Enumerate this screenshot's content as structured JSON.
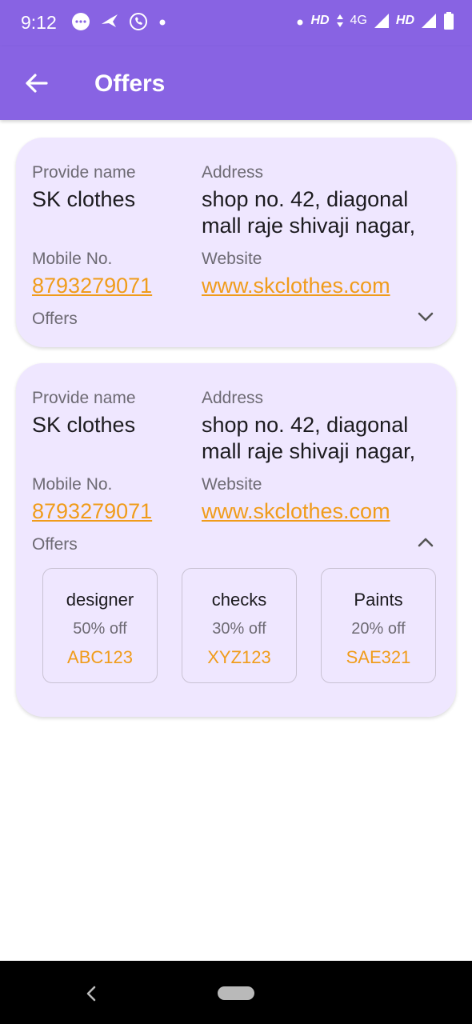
{
  "status_bar": {
    "time": "9:12",
    "left_icons": [
      "messenger-icon",
      "notification-icon",
      "call-icon",
      "dot-icon"
    ],
    "right_text": [
      "HD",
      "4G",
      "HD"
    ],
    "right_icons": [
      "dot-icon",
      "data-arrows-icon",
      "signal-icon",
      "signal-icon",
      "battery-icon"
    ]
  },
  "app_bar": {
    "title": "Offers",
    "back_icon": "arrow-left-icon"
  },
  "cards": [
    {
      "provider_label": "Provide name",
      "provider_value": "SK clothes",
      "address_label": "Address",
      "address_line1": "shop no. 42, diagonal",
      "address_line2": "mall raje shivaji nagar,",
      "mobile_label": "Mobile No.",
      "mobile_value": "8793279071",
      "website_label": "Website",
      "website_value": "www.skclothes.com",
      "offers_label": "Offers",
      "expanded": false
    },
    {
      "provider_label": "Provide name",
      "provider_value": "SK clothes",
      "address_label": "Address",
      "address_line1": "shop no. 42, diagonal",
      "address_line2": "mall raje shivaji nagar,",
      "mobile_label": "Mobile No.",
      "mobile_value": "8793279071",
      "website_label": "Website",
      "website_value": "www.skclothes.com",
      "offers_label": "Offers",
      "expanded": true,
      "offers": [
        {
          "name": "designer",
          "discount": "50% off",
          "code": "ABC123"
        },
        {
          "name": "checks",
          "discount": "30% off",
          "code": "XYZ123"
        },
        {
          "name": "Paints",
          "discount": "20% off",
          "code": "SAE321"
        }
      ]
    }
  ],
  "colors": {
    "primary": "#8863e3",
    "card_bg": "#efe7ff",
    "accent": "#f09c1b",
    "label": "#6d6a73",
    "text": "#1c1b1f"
  },
  "nav_bar": {
    "icons": [
      "nav-back-icon",
      "home-pill-icon"
    ]
  }
}
